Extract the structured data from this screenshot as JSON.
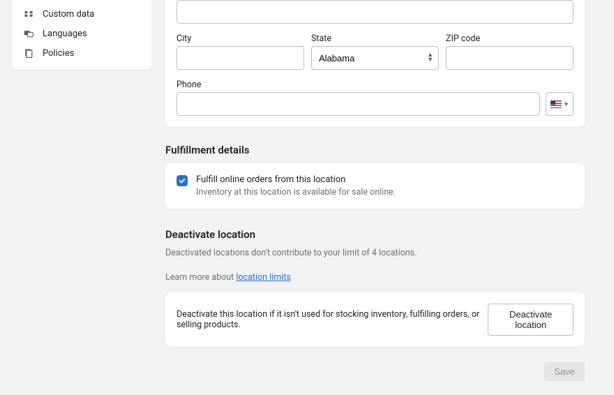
{
  "sidebar": {
    "items": [
      {
        "label": "Custom data"
      },
      {
        "label": "Languages"
      },
      {
        "label": "Policies"
      }
    ]
  },
  "address": {
    "city_label": "City",
    "city_value": "",
    "state_label": "State",
    "state_value": "Alabama",
    "zip_label": "ZIP code",
    "zip_value": "",
    "phone_label": "Phone",
    "phone_value": ""
  },
  "fulfillment": {
    "title": "Fulfillment details",
    "checkbox_label": "Fulfill online orders from this location",
    "checkbox_sub": "Inventory at this location is available for sale online.",
    "checked": true
  },
  "deactivate": {
    "title": "Deactivate location",
    "subtitle": "Deactivated locations don't contribute to your limit of 4 locations.",
    "learn_more_prefix": "Learn more about ",
    "learn_more_link": "location limits",
    "card_text": "Deactivate this location if it isn't used for stocking inventory, fulfilling orders, or selling products.",
    "button_label": "Deactivate location"
  },
  "save_label": "Save"
}
